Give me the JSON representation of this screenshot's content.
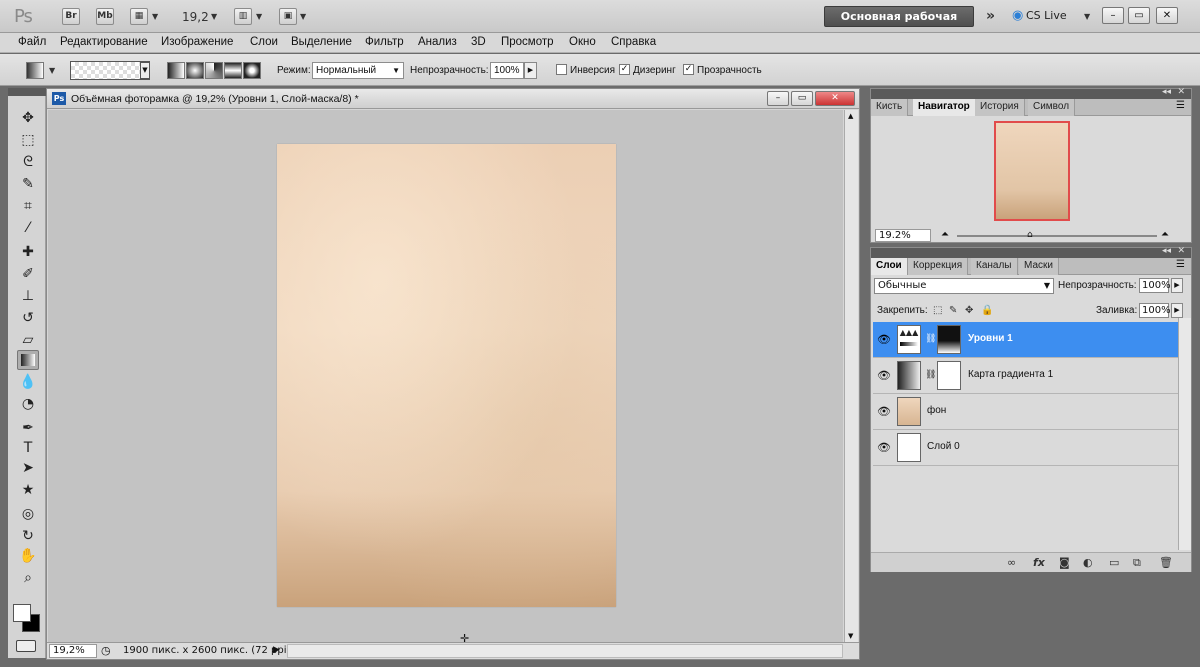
{
  "app": {
    "logo": "Ps",
    "bridge_btn": "Br",
    "minibridge_btn": "Mb",
    "zoom": "19,2",
    "workspace": "Основная рабочая среда",
    "cs_live": "CS Live"
  },
  "menu": [
    "Файл",
    "Редактирование",
    "Изображение",
    "Слои",
    "Выделение",
    "Фильтр",
    "Анализ",
    "3D",
    "Просмотр",
    "Окно",
    "Справка"
  ],
  "options": {
    "mode_label": "Режим:",
    "mode_value": "Нормальный",
    "opacity_label": "Непрозрачность:",
    "opacity_value": "100%",
    "inverse_label": "Инверсия",
    "inverse_checked": false,
    "dither_label": "Дизеринг",
    "dither_checked": true,
    "transparency_label": "Прозрачность",
    "transparency_checked": true
  },
  "document": {
    "title": "Объёмная фоторамка @ 19,2% (Уровни 1, Слой-маска/8) *",
    "status_zoom": "19,2%",
    "status_info": "1900 пикс. x 2600 пикс. (72 ppi)"
  },
  "navigator": {
    "tabs": [
      "Кисть",
      "Навигатор",
      "История",
      "Символ"
    ],
    "active_tab": "Навигатор",
    "zoom": "19.2%"
  },
  "layers": {
    "tabs": [
      "Слои",
      "Коррекция",
      "Каналы",
      "Маски"
    ],
    "active_tab": "Слои",
    "blend_mode": "Обычные",
    "opacity_label": "Непрозрачность:",
    "opacity_value": "100%",
    "lock_label": "Закрепить:",
    "fill_label": "Заливка:",
    "fill_value": "100%",
    "items": [
      {
        "name": "Уровни 1",
        "selected": true
      },
      {
        "name": "Карта градиента 1",
        "selected": false
      },
      {
        "name": "фон",
        "selected": false
      },
      {
        "name": "Слой 0",
        "selected": false
      }
    ]
  },
  "colors": {
    "selection": "#3d8ef0",
    "paper": "#eccfb4",
    "nav_frame": "#e14b4b"
  }
}
